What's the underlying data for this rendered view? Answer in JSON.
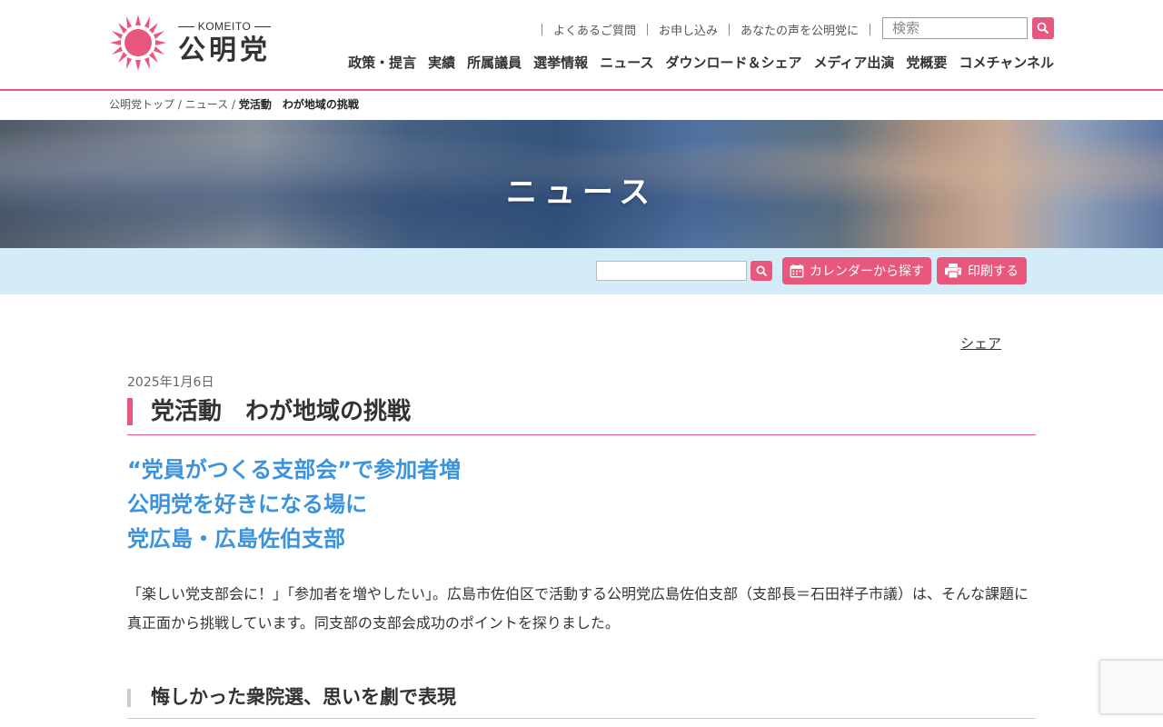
{
  "logo": {
    "en": "KOMEITO",
    "ja": "公明党"
  },
  "util_links": [
    "よくあるご質問",
    "お申し込み",
    "あなたの声を公明党に"
  ],
  "search": {
    "placeholder": "検索"
  },
  "gnav": [
    "政策・提言",
    "実績",
    "所属議員",
    "選挙情報",
    "ニュース",
    "ダウンロード＆シェア",
    "メディア出演",
    "党概要",
    "コメチャンネル"
  ],
  "breadcrumb": {
    "home": "公明党トップ",
    "sep": "/",
    "section": "ニュース",
    "current": "党活動　わが地域の挑戦"
  },
  "hero": {
    "title": "ニュース"
  },
  "toolbar": {
    "calendar_label": "カレンダーから探す",
    "print_label": "印刷する"
  },
  "article": {
    "share": "シェア",
    "date": "2025年1月6日",
    "title": "党活動　わが地域の挑戦",
    "lead": [
      "“党員がつくる支部会”で参加者増",
      "公明党を好きになる場に",
      "党広島・広島佐伯支部"
    ],
    "body": "「楽しい党支部会に！」「参加者を増やしたい」。広島市佐伯区で活動する公明党広島佐伯支部（支部長＝石田祥子市議）は、そんな課題に真正面から挑戦しています。同支部の支部会成功のポイントを探りました。",
    "subhead": "悔しかった衆院選、思いを劇で表現"
  },
  "colors": {
    "accent": "#e8577e",
    "lead": "#3b93dd",
    "toolbar_bg": "#d4ecf8"
  }
}
